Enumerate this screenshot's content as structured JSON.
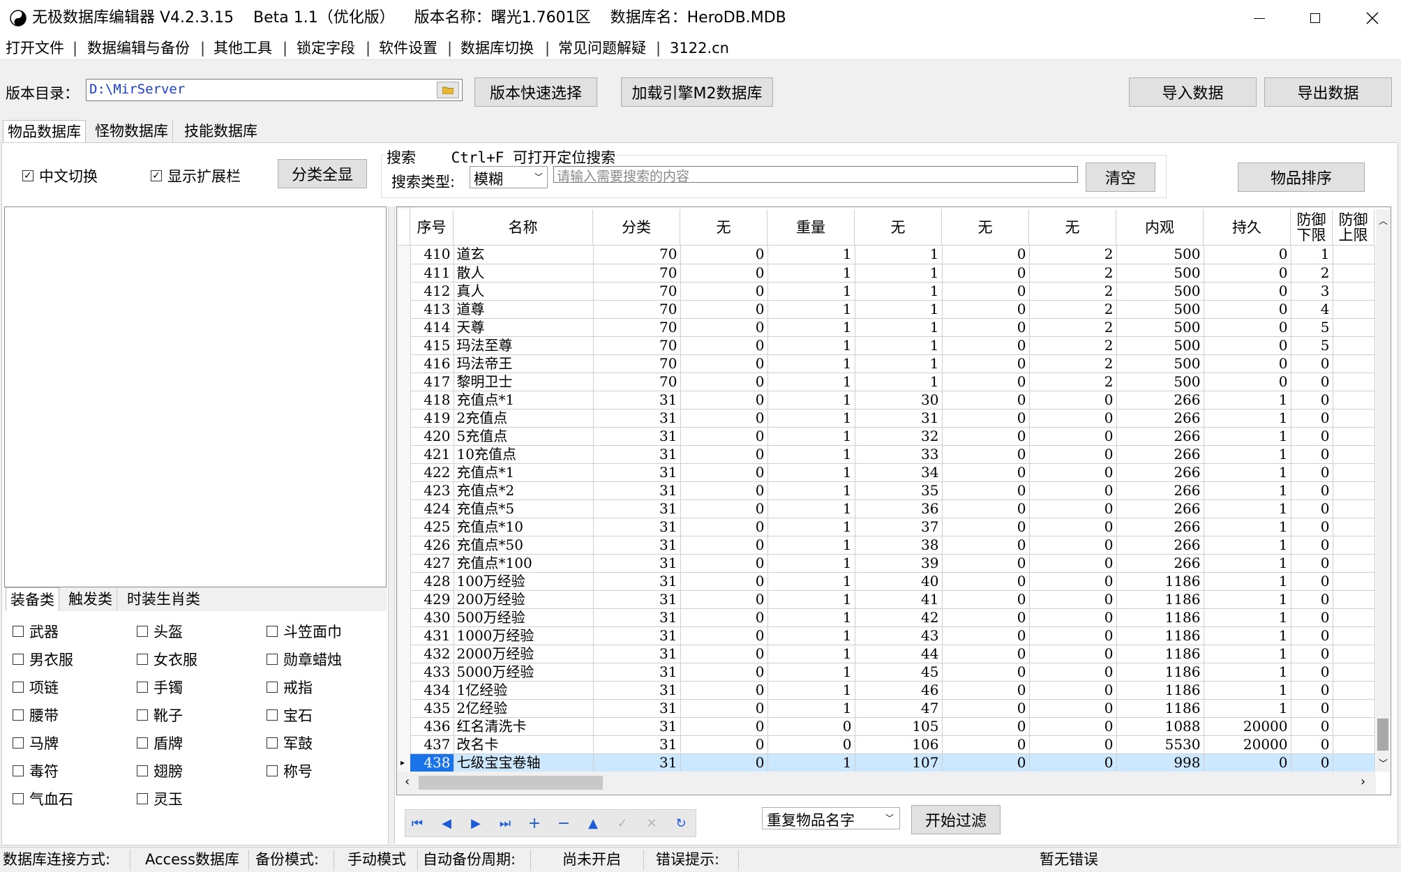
{
  "window": {
    "title": "无极数据库编辑器 V4.2.3.15    Beta 1.1（优化版）    版本名称：曙光1.7601区    数据库名：HeroDB.MDB"
  },
  "menu": [
    "打开文件",
    "数据编辑与备份",
    "其他工具",
    "锁定字段",
    "软件设置",
    "数据库切换",
    "常见问题解疑",
    "3122.cn"
  ],
  "toolbar": {
    "dir_label": "版本目录：",
    "dir_value": "D:\\MirServer",
    "quick_select": "版本快速选择",
    "load_m2": "加载引擎M2数据库",
    "import": "导入数据",
    "export": "导出数据"
  },
  "tabs": [
    "物品数据库",
    "怪物数据库",
    "技能数据库"
  ],
  "options": {
    "chinese_switch": "中文切换",
    "show_ext": "显示扩展栏",
    "show_all": "分类全显"
  },
  "search": {
    "title": "搜索    Ctrl+F 可打开定位搜索",
    "type_label": "搜索类型:",
    "type_value": "模糊",
    "placeholder": "请输入需要搜索的内容",
    "clear": "清空",
    "sort": "物品排序"
  },
  "category_tabs": [
    "装备类",
    "触发类",
    "时装生肖类"
  ],
  "categories": [
    "武器",
    "头盔",
    "斗笠面巾",
    "男衣服",
    "女衣服",
    "勋章蜡烛",
    "项链",
    "手镯",
    "戒指",
    "腰带",
    "靴子",
    "宝石",
    "马牌",
    "盾牌",
    "军鼓",
    "毒符",
    "翅膀",
    "称号",
    "气血石",
    "灵玉"
  ],
  "table": {
    "headers": [
      "序号",
      "名称",
      "分类",
      "无",
      "重量",
      "无",
      "无",
      "无",
      "内观",
      "持久",
      "防御\n下限",
      "防御\n上限"
    ],
    "rows": [
      [
        "410",
        "道玄",
        "70",
        "0",
        "1",
        "1",
        "0",
        "2",
        "500",
        "0",
        "1"
      ],
      [
        "411",
        "散人",
        "70",
        "0",
        "1",
        "1",
        "0",
        "2",
        "500",
        "0",
        "2"
      ],
      [
        "412",
        "真人",
        "70",
        "0",
        "1",
        "1",
        "0",
        "2",
        "500",
        "0",
        "3"
      ],
      [
        "413",
        "道尊",
        "70",
        "0",
        "1",
        "1",
        "0",
        "2",
        "500",
        "0",
        "4"
      ],
      [
        "414",
        "天尊",
        "70",
        "0",
        "1",
        "1",
        "0",
        "2",
        "500",
        "0",
        "5"
      ],
      [
        "415",
        "玛法至尊",
        "70",
        "0",
        "1",
        "1",
        "0",
        "2",
        "500",
        "0",
        "5"
      ],
      [
        "416",
        "玛法帝王",
        "70",
        "0",
        "1",
        "1",
        "0",
        "2",
        "500",
        "0",
        "0"
      ],
      [
        "417",
        "黎明卫士",
        "70",
        "0",
        "1",
        "1",
        "0",
        "2",
        "500",
        "0",
        "0"
      ],
      [
        "418",
        "充值点*1",
        "31",
        "0",
        "1",
        "30",
        "0",
        "0",
        "266",
        "1",
        "0"
      ],
      [
        "419",
        "2充值点",
        "31",
        "0",
        "1",
        "31",
        "0",
        "0",
        "266",
        "1",
        "0"
      ],
      [
        "420",
        "5充值点",
        "31",
        "0",
        "1",
        "32",
        "0",
        "0",
        "266",
        "1",
        "0"
      ],
      [
        "421",
        "10充值点",
        "31",
        "0",
        "1",
        "33",
        "0",
        "0",
        "266",
        "1",
        "0"
      ],
      [
        "422",
        "充值点*1",
        "31",
        "0",
        "1",
        "34",
        "0",
        "0",
        "266",
        "1",
        "0"
      ],
      [
        "423",
        "充值点*2",
        "31",
        "0",
        "1",
        "35",
        "0",
        "0",
        "266",
        "1",
        "0"
      ],
      [
        "424",
        "充值点*5",
        "31",
        "0",
        "1",
        "36",
        "0",
        "0",
        "266",
        "1",
        "0"
      ],
      [
        "425",
        "充值点*10",
        "31",
        "0",
        "1",
        "37",
        "0",
        "0",
        "266",
        "1",
        "0"
      ],
      [
        "426",
        "充值点*50",
        "31",
        "0",
        "1",
        "38",
        "0",
        "0",
        "266",
        "1",
        "0"
      ],
      [
        "427",
        "充值点*100",
        "31",
        "0",
        "1",
        "39",
        "0",
        "0",
        "266",
        "1",
        "0"
      ],
      [
        "428",
        "100万经验",
        "31",
        "0",
        "1",
        "40",
        "0",
        "0",
        "1186",
        "1",
        "0"
      ],
      [
        "429",
        "200万经验",
        "31",
        "0",
        "1",
        "41",
        "0",
        "0",
        "1186",
        "1",
        "0"
      ],
      [
        "430",
        "500万经验",
        "31",
        "0",
        "1",
        "42",
        "0",
        "0",
        "1186",
        "1",
        "0"
      ],
      [
        "431",
        "1000万经验",
        "31",
        "0",
        "1",
        "43",
        "0",
        "0",
        "1186",
        "1",
        "0"
      ],
      [
        "432",
        "2000万经验",
        "31",
        "0",
        "1",
        "44",
        "0",
        "0",
        "1186",
        "1",
        "0"
      ],
      [
        "433",
        "5000万经验",
        "31",
        "0",
        "1",
        "45",
        "0",
        "0",
        "1186",
        "1",
        "0"
      ],
      [
        "434",
        "1亿经验",
        "31",
        "0",
        "1",
        "46",
        "0",
        "0",
        "1186",
        "1",
        "0"
      ],
      [
        "435",
        "2亿经验",
        "31",
        "0",
        "1",
        "47",
        "0",
        "0",
        "1186",
        "1",
        "0"
      ],
      [
        "436",
        "红名清洗卡",
        "31",
        "0",
        "0",
        "105",
        "0",
        "0",
        "1088",
        "20000",
        "0"
      ],
      [
        "437",
        "改名卡",
        "31",
        "0",
        "0",
        "106",
        "0",
        "0",
        "5530",
        "20000",
        "0"
      ],
      [
        "438",
        "七级宝宝卷轴",
        "31",
        "0",
        "1",
        "107",
        "0",
        "0",
        "998",
        "0",
        "0"
      ]
    ]
  },
  "filter": {
    "select_value": "重复物品名字",
    "start": "开始过滤"
  },
  "status": {
    "conn_label": "数据库连接方式:",
    "conn_value": "Access数据库",
    "backup_label": "备份模式:",
    "backup_value": "手动模式",
    "auto_label": "自动备份周期:",
    "auto_value": "尚未开启",
    "error_label": "错误提示:",
    "error_value": "暂无错误"
  }
}
